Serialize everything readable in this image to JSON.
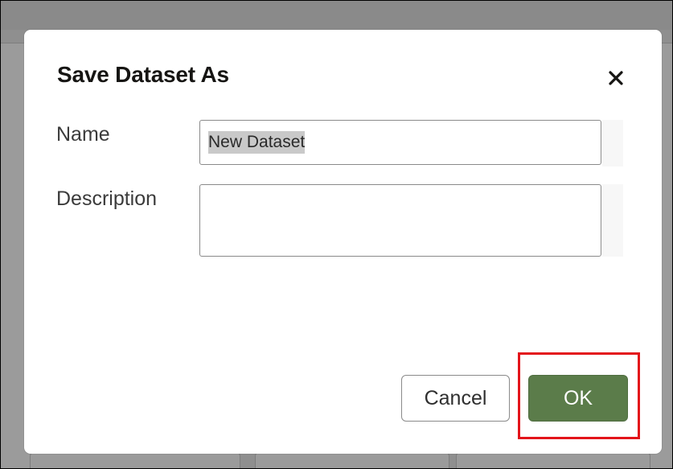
{
  "dialog": {
    "title": "Save Dataset As",
    "close_icon": "close-icon",
    "name_label": "Name",
    "name_value": "New Dataset",
    "description_label": "Description",
    "description_value": "",
    "cancel_label": "Cancel",
    "ok_label": "OK"
  },
  "colors": {
    "ok_button": "#5b7c4a",
    "highlight": "#e3141a",
    "backdrop": "#8f8f8f"
  }
}
